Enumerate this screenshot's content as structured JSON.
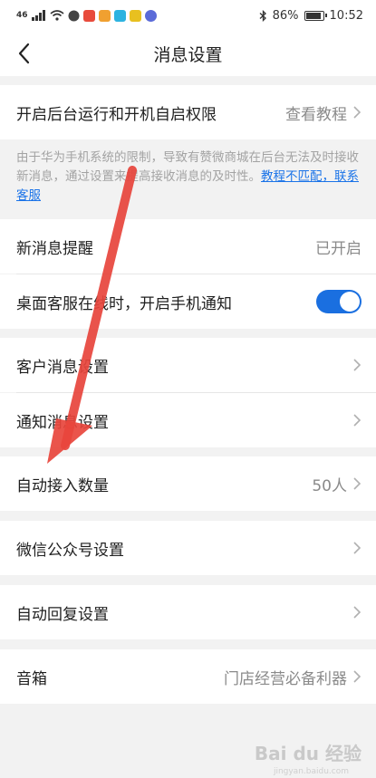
{
  "status": {
    "left_text": "46",
    "battery": "86%",
    "time": "10:52"
  },
  "nav": {
    "title": "消息设置"
  },
  "rows": {
    "autostart": {
      "label": "开启后台运行和开机自启权限",
      "value": "查看教程"
    },
    "new_msg": {
      "label": "新消息提醒",
      "value": "已开启"
    },
    "desktop_notify": {
      "label": "桌面客服在线时，开启手机通知",
      "toggle_on": true
    },
    "customer_msg": {
      "label": "客户消息设置"
    },
    "notice_msg": {
      "label": "通知消息设置"
    },
    "auto_accept": {
      "label": "自动接入数量",
      "value": "50人"
    },
    "wechat_oa": {
      "label": "微信公众号设置"
    },
    "auto_reply": {
      "label": "自动回复设置"
    },
    "speaker": {
      "label": "音箱",
      "value": "门店经营必备利器"
    }
  },
  "note": {
    "text": "由于华为手机系统的限制，导致有赞微商城在后台无法及时接收新消息，通过设置来提高接收消息的及时性。",
    "link": "教程不匹配，联系客服"
  },
  "watermark": {
    "brand": "Bai du 经验",
    "sub": "jingyan.baidu.com"
  },
  "colors": {
    "accent": "#1a6fe0",
    "annotation_arrow": "#e8453c"
  }
}
